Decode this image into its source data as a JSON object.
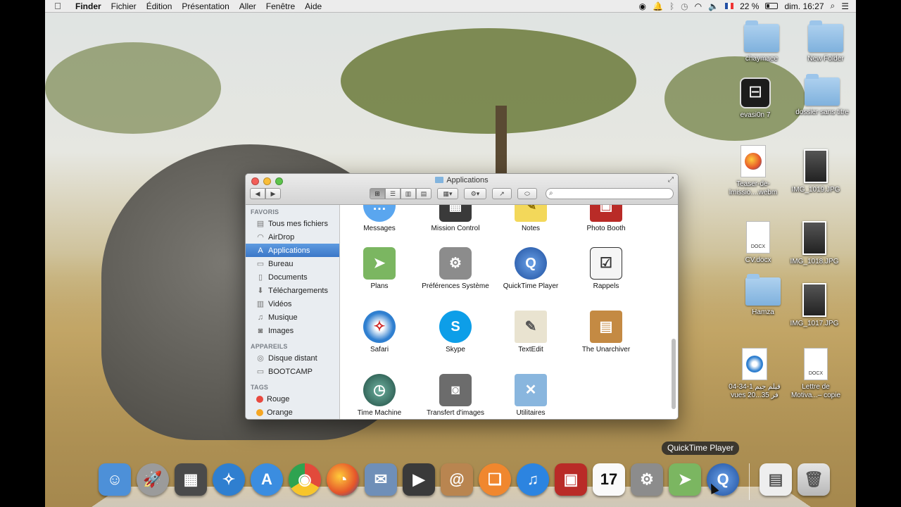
{
  "menubar": {
    "app": "Finder",
    "items": [
      "Fichier",
      "Édition",
      "Présentation",
      "Aller",
      "Fenêtre",
      "Aide"
    ],
    "battery": "22 %",
    "clock": "dim. 16:27"
  },
  "desktop": {
    "icons": [
      {
        "label": "chaymaee",
        "kind": "folder"
      },
      {
        "label": "New Folder",
        "kind": "folder"
      },
      {
        "label": "evasi0n 7",
        "kind": "app"
      },
      {
        "label": "dossier sans titre",
        "kind": "folder"
      },
      {
        "label": "Teaser-de-lmissio....webm",
        "kind": "firefox-doc"
      },
      {
        "label": "IMG_1019.JPG",
        "kind": "photo"
      },
      {
        "label": "CV.docx",
        "kind": "docx"
      },
      {
        "label": "IMG_1018.JPG",
        "kind": "photo"
      },
      {
        "label": "Hamza",
        "kind": "folder"
      },
      {
        "label": "IMG_1017.JPG",
        "kind": "photo"
      },
      {
        "label": "04-34-1 قيلم جيم vues 20...35 فر",
        "kind": "safari-doc"
      },
      {
        "label": "Lettre de Motiva...– copie",
        "kind": "docx"
      }
    ],
    "docx_tag": "DOCX"
  },
  "finder": {
    "title": "Applications",
    "search_placeholder": "",
    "sidebar": {
      "favoris_header": "FAVORIS",
      "favoris": [
        {
          "label": "Tous mes fichiers",
          "icon": "all-files-icon"
        },
        {
          "label": "AirDrop",
          "icon": "airdrop-icon"
        },
        {
          "label": "Applications",
          "icon": "applications-icon",
          "selected": true
        },
        {
          "label": "Bureau",
          "icon": "desktop-icon"
        },
        {
          "label": "Documents",
          "icon": "documents-icon"
        },
        {
          "label": "Téléchargements",
          "icon": "downloads-icon"
        },
        {
          "label": "Vidéos",
          "icon": "movies-icon"
        },
        {
          "label": "Musique",
          "icon": "music-icon"
        },
        {
          "label": "Images",
          "icon": "pictures-icon"
        }
      ],
      "appareils_header": "APPAREILS",
      "appareils": [
        {
          "label": "Disque distant",
          "icon": "remote-disc-icon"
        },
        {
          "label": "BOOTCAMP",
          "icon": "drive-icon"
        }
      ],
      "tags_header": "TAGS",
      "tags": [
        {
          "label": "Rouge",
          "color": "#e8493f"
        },
        {
          "label": "Orange",
          "color": "#f5a623"
        }
      ]
    },
    "apps": [
      {
        "label": "Messages",
        "color": "#5aa6ef"
      },
      {
        "label": "Mission Control",
        "color": "#3a3a3a"
      },
      {
        "label": "Notes",
        "color": "#f3d85a"
      },
      {
        "label": "Photo Booth",
        "color": "#b92b27"
      },
      {
        "label": "Plans",
        "color": "#7bb661"
      },
      {
        "label": "Préférences Système",
        "color": "#8c8c8c"
      },
      {
        "label": "QuickTime Player",
        "color": "#2a63b8"
      },
      {
        "label": "Rappels",
        "color": "#f5f5f5"
      },
      {
        "label": "Safari",
        "color": "#2f7fd0"
      },
      {
        "label": "Skype",
        "color": "#0d9ee8"
      },
      {
        "label": "TextEdit",
        "color": "#e9e3d0"
      },
      {
        "label": "The Unarchiver",
        "color": "#c48a43"
      },
      {
        "label": "Time Machine",
        "color": "#2d6a5b"
      },
      {
        "label": "Transfert d'images",
        "color": "#6c6c6c"
      },
      {
        "label": "Utilitaires",
        "color": "#89b6de"
      }
    ]
  },
  "dock": {
    "tooltip": "QuickTime Player",
    "items": [
      {
        "name": "finder",
        "color": "#4d90d8",
        "glyph": "☺"
      },
      {
        "name": "launchpad",
        "color": "#9b9b9b",
        "glyph": "🚀"
      },
      {
        "name": "mission-control",
        "color": "#4a4a4a",
        "glyph": "▦"
      },
      {
        "name": "safari",
        "color": "#2f7fd0",
        "glyph": "✧"
      },
      {
        "name": "app-store",
        "color": "#3b8de0",
        "glyph": "A"
      },
      {
        "name": "chrome",
        "color": "#e24a3b",
        "glyph": "◉"
      },
      {
        "name": "firefox",
        "color": "#e5552a",
        "glyph": "◔"
      },
      {
        "name": "mail",
        "color": "#6f8fb8",
        "glyph": "✉"
      },
      {
        "name": "facetime",
        "color": "#3a3a3a",
        "glyph": "▶"
      },
      {
        "name": "contacts",
        "color": "#b98550",
        "glyph": "@"
      },
      {
        "name": "ibooks",
        "color": "#f0872e",
        "glyph": "❑"
      },
      {
        "name": "itunes",
        "color": "#2c84e0",
        "glyph": "♫"
      },
      {
        "name": "photo-booth",
        "color": "#b92b27",
        "glyph": "▣"
      },
      {
        "name": "calendar",
        "color": "#fafafa",
        "glyph": "17"
      },
      {
        "name": "system-preferences",
        "color": "#8c8c8c",
        "glyph": "⚙"
      },
      {
        "name": "maps",
        "color": "#7bb661",
        "glyph": "➤"
      },
      {
        "name": "quicktime",
        "color": "#2a63b8",
        "glyph": "Q"
      },
      {
        "name": "downloads-stack",
        "color": "#eeeeee",
        "glyph": "▤"
      },
      {
        "name": "trash",
        "color": "#cfcfcf",
        "glyph": "🗑"
      }
    ]
  }
}
